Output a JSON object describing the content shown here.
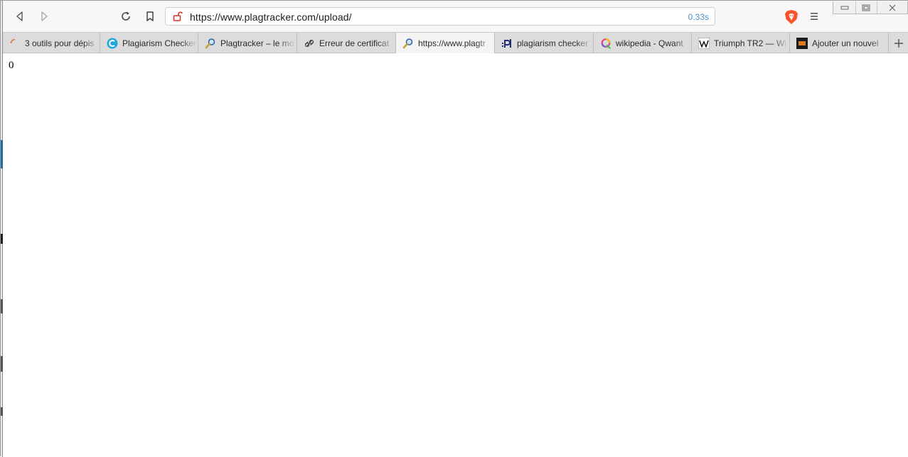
{
  "browser": {
    "url": "https://www.plagtracker.com/upload/",
    "load_time": "0.33s",
    "colors": {
      "brave_orange": "#fb542b",
      "time_blue": "#4a90c8",
      "lock_red": "#d9342b"
    }
  },
  "tabs": [
    {
      "title": "3 outils pour dépis",
      "icon": "loading-ring-icon",
      "active": false
    },
    {
      "title": "Plagiarism Checker",
      "icon": "copyleaks-c-icon",
      "active": false
    },
    {
      "title": "Plagtracker – le mo",
      "icon": "plagtracker-magnifier-icon",
      "active": false
    },
    {
      "title": "Erreur de certificat",
      "icon": "broken-link-icon",
      "active": false
    },
    {
      "title": "https://www.plagtr",
      "icon": "plagtracker-magnifier-icon",
      "active": true
    },
    {
      "title": "plagiarism checker",
      "icon": "pl-logo-icon",
      "active": false
    },
    {
      "title": "wikipedia - Qwant",
      "icon": "qwant-icon",
      "active": false
    },
    {
      "title": "Triumph TR2 — Wi",
      "icon": "wikipedia-w-icon",
      "active": false
    },
    {
      "title": "Ajouter un nouvel",
      "icon": "orange-square-icon",
      "active": false
    }
  ],
  "page": {
    "content": "0"
  }
}
